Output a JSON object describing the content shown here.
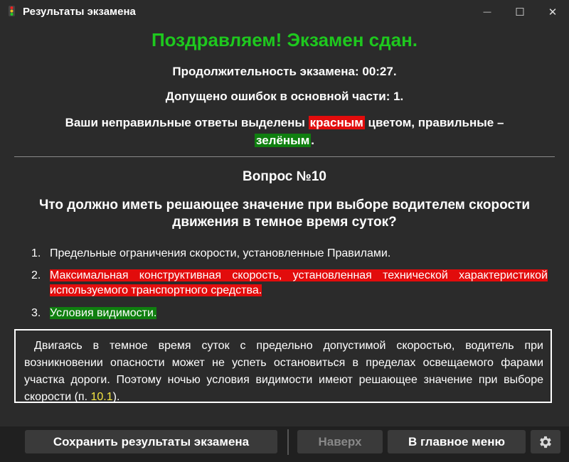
{
  "window": {
    "title": "Результаты экзамена",
    "minimize_glyph": "—",
    "maximize_glyph": "☐",
    "close_glyph": "✕"
  },
  "result": {
    "headline": "Поздравляем! Экзамен сдан.",
    "duration": "Продолжительность экзамена: 00:27.",
    "errors": "Допущено ошибок в основной части: 1.",
    "legend_pre": "Ваши неправильные ответы выделены ",
    "legend_red": "красным",
    "legend_mid": " цветом, правильные – ",
    "legend_green": "зелёным",
    "legend_post": "."
  },
  "question": {
    "number": "Вопрос №10",
    "text": "Что должно иметь решающее значение при выборе водителем скорости движения в темное время суток?",
    "answers": [
      {
        "num": "1.",
        "text": "Предельные ограничения скорости, установленные Правилами."
      },
      {
        "num": "2.",
        "text": "Максимальная конструктивная скорость, установленная технической характеристикой используемого транспортного средства."
      },
      {
        "num": "3.",
        "text": "Условия видимости."
      }
    ]
  },
  "explanation": {
    "text": "Двигаясь в темное время суток с предельно допустимой скоростью, водитель при возникновении опасности может не успеть остановиться в пределах освещаемого фарами участка дороги. Поэтому ночью условия видимости имеют решающее значение при выборе скорости (п. ",
    "ref": "10.1",
    "tail": ")."
  },
  "buttons": {
    "save": "Сохранить результаты экзамена",
    "up": "Наверх",
    "main_menu": "В главное меню",
    "settings_icon": "gear-icon"
  },
  "colors": {
    "success": "#1ec81e",
    "wrong": "#e20c0c",
    "correct": "#0f7f0f",
    "reference": "#f5e642"
  }
}
